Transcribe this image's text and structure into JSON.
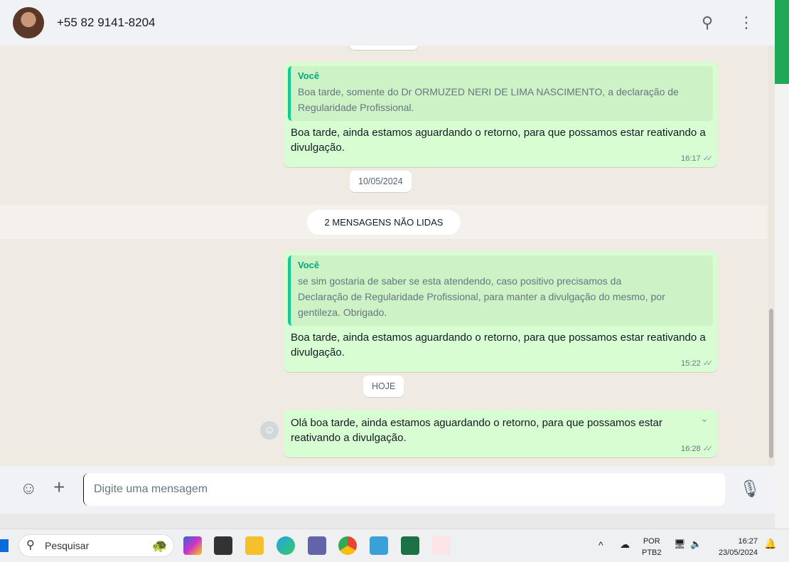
{
  "header": {
    "contact": "+55 82 9141-8204"
  },
  "messages": [
    {
      "quote_author": "Você",
      "quote_text": "Boa tarde, somente do Dr ORMUZED NERI DE LIMA NASCIMENTO, a declaração de Regularidade Profissional.",
      "text": "Boa tarde, ainda estamos aguardando o retorno, para que possamos estar reativando a divulgação.",
      "time": "16:17"
    },
    {
      "quote_author": "Você",
      "quote_text": "se sim gostaria de saber se esta atendendo, caso positivo precisamos da Declaração de Regularidade Profissional, para manter a divulgação do mesmo, por gentileza. Obrigado.",
      "text": "Boa tarde, ainda estamos aguardando o retorno, para que possamos estar reativando a divulgação.",
      "time": "15:22"
    },
    {
      "text": "Olá boa tarde, ainda estamos aguardando o retorno, para que possamos estar reativando a divulgação.",
      "time": "16:28"
    }
  ],
  "dates": {
    "d1": "10/05/2024",
    "d2": "HOJE"
  },
  "unread": "2 MENSAGENS NÃO LIDAS",
  "composer": {
    "placeholder": "Digite uma mensagem"
  },
  "taskbar": {
    "search": "Pesquisar",
    "lang1": "POR",
    "lang2": "PTB2",
    "time": "16:27",
    "date": "23/05/2024"
  },
  "colors": {
    "bubble": "#d9fdd3",
    "accent": "#1fa855"
  }
}
